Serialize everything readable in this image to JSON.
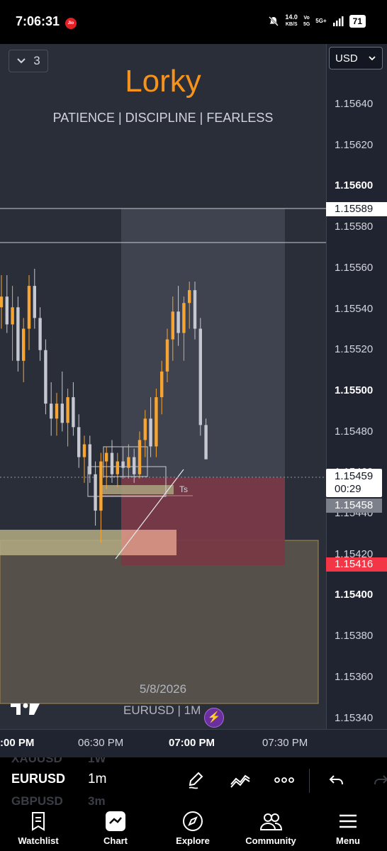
{
  "status_bar": {
    "time": "7:06:31",
    "carrier_badge": "Jio",
    "data_speed_value": "14.0",
    "data_speed_unit": "KB/S",
    "volte_line1": "Vo",
    "volte_line2": "5G",
    "network": "5G+",
    "battery": "71"
  },
  "chart_header": {
    "interval_count": "3",
    "currency": "USD"
  },
  "branding": {
    "title": "Lorky",
    "subtitle": "PATIENCE | DISCIPLINE | FEARLESS"
  },
  "price_axis": {
    "ticks": [
      {
        "label": "1.15640",
        "bold": false
      },
      {
        "label": "1.15620",
        "bold": false
      },
      {
        "label": "1.15600",
        "bold": true
      },
      {
        "label": "1.15580",
        "bold": false
      },
      {
        "label": "1.15560",
        "bold": false
      },
      {
        "label": "1.15540",
        "bold": false
      },
      {
        "label": "1.15520",
        "bold": false
      },
      {
        "label": "1.15500",
        "bold": true
      },
      {
        "label": "1.15480",
        "bold": false
      },
      {
        "label": "1.15460",
        "bold": false
      },
      {
        "label": "1.15440",
        "bold": false
      },
      {
        "label": "1.15420",
        "bold": false
      },
      {
        "label": "1.15400",
        "bold": true
      },
      {
        "label": "1.15380",
        "bold": false
      },
      {
        "label": "1.15360",
        "bold": false
      },
      {
        "label": "1.15340",
        "bold": false
      }
    ],
    "tag_white": "1.15589",
    "tag_current_price": "1.15459",
    "tag_current_countdown": "00:29",
    "tag_gray": "1.15458",
    "tag_red": "1.15416"
  },
  "time_axis": {
    "labels": [
      {
        "label": ":00 PM",
        "bold": true
      },
      {
        "label": "06:30 PM",
        "bold": false
      },
      {
        "label": "07:00 PM",
        "bold": true
      },
      {
        "label": "07:30 PM",
        "bold": false
      }
    ]
  },
  "annotations": {
    "ts_label": "Ts"
  },
  "watermark": {
    "date": "5/8/2026",
    "symbol": "EURUSD | 1M"
  },
  "toolbar": {
    "above_symbol": "XAUUSD",
    "above_interval": "1W",
    "symbol": "EURUSD",
    "interval": "1m",
    "below_symbol": "GBPUSD",
    "below_interval": "3m"
  },
  "bottom_nav": {
    "items": [
      {
        "label": "Watchlist",
        "icon": "watchlist-icon"
      },
      {
        "label": "Chart",
        "icon": "chart-icon"
      },
      {
        "label": "Explore",
        "icon": "compass-icon"
      },
      {
        "label": "Community",
        "icon": "community-icon"
      },
      {
        "label": "Menu",
        "icon": "menu-icon"
      }
    ]
  },
  "colors": {
    "chart_bg": "#2a2e39",
    "up_candle": "#f7a532",
    "down_candle": "#c5c8d0",
    "brand": "#f7931a",
    "stop_zone": "#b03a48",
    "demand_zone": "#4f4940"
  },
  "chart_data": {
    "type": "candlestick",
    "symbol": "EURUSD",
    "interval": "1m",
    "y_axis_range": [
      1.15333,
      1.15653
    ],
    "current_price": 1.15459,
    "candles": [
      {
        "o": 1.1553,
        "h": 1.15545,
        "l": 1.1552,
        "c": 1.15535
      },
      {
        "o": 1.15535,
        "h": 1.15545,
        "l": 1.15518,
        "c": 1.15522
      },
      {
        "o": 1.15522,
        "h": 1.1554,
        "l": 1.15505,
        "c": 1.1553
      },
      {
        "o": 1.1553,
        "h": 1.15535,
        "l": 1.155,
        "c": 1.15505
      },
      {
        "o": 1.15505,
        "h": 1.15525,
        "l": 1.15495,
        "c": 1.1552
      },
      {
        "o": 1.1552,
        "h": 1.15545,
        "l": 1.1551,
        "c": 1.1554
      },
      {
        "o": 1.1554,
        "h": 1.15548,
        "l": 1.1552,
        "c": 1.15525
      },
      {
        "o": 1.15525,
        "h": 1.1553,
        "l": 1.15505,
        "c": 1.1551
      },
      {
        "o": 1.1551,
        "h": 1.15515,
        "l": 1.1548,
        "c": 1.15485
      },
      {
        "o": 1.15485,
        "h": 1.15495,
        "l": 1.1547,
        "c": 1.15478
      },
      {
        "o": 1.15478,
        "h": 1.1549,
        "l": 1.1547,
        "c": 1.15485
      },
      {
        "o": 1.15485,
        "h": 1.155,
        "l": 1.15472,
        "c": 1.15476
      },
      {
        "o": 1.15476,
        "h": 1.15492,
        "l": 1.15465,
        "c": 1.15488
      },
      {
        "o": 1.15488,
        "h": 1.15495,
        "l": 1.1547,
        "c": 1.15474
      },
      {
        "o": 1.15474,
        "h": 1.1548,
        "l": 1.15455,
        "c": 1.1546
      },
      {
        "o": 1.1546,
        "h": 1.1547,
        "l": 1.15448,
        "c": 1.15466
      },
      {
        "o": 1.15466,
        "h": 1.1547,
        "l": 1.15448,
        "c": 1.15452
      },
      {
        "o": 1.15452,
        "h": 1.15458,
        "l": 1.15428,
        "c": 1.15435
      },
      {
        "o": 1.15435,
        "h": 1.15462,
        "l": 1.1542,
        "c": 1.15458
      },
      {
        "o": 1.15458,
        "h": 1.15465,
        "l": 1.15445,
        "c": 1.15462
      },
      {
        "o": 1.15462,
        "h": 1.15468,
        "l": 1.15448,
        "c": 1.15452
      },
      {
        "o": 1.15452,
        "h": 1.15462,
        "l": 1.15446,
        "c": 1.15458
      },
      {
        "o": 1.15458,
        "h": 1.15465,
        "l": 1.1545,
        "c": 1.15455
      },
      {
        "o": 1.15455,
        "h": 1.15466,
        "l": 1.1545,
        "c": 1.1546
      },
      {
        "o": 1.1546,
        "h": 1.15464,
        "l": 1.15448,
        "c": 1.15452
      },
      {
        "o": 1.15452,
        "h": 1.15472,
        "l": 1.1545,
        "c": 1.15468
      },
      {
        "o": 1.15468,
        "h": 1.15482,
        "l": 1.1546,
        "c": 1.15478
      },
      {
        "o": 1.15478,
        "h": 1.15488,
        "l": 1.1546,
        "c": 1.15465
      },
      {
        "o": 1.15465,
        "h": 1.15492,
        "l": 1.1546,
        "c": 1.15488
      },
      {
        "o": 1.15488,
        "h": 1.15505,
        "l": 1.1548,
        "c": 1.155
      },
      {
        "o": 1.155,
        "h": 1.1552,
        "l": 1.15495,
        "c": 1.15515
      },
      {
        "o": 1.15515,
        "h": 1.15535,
        "l": 1.15505,
        "c": 1.15528
      },
      {
        "o": 1.15528,
        "h": 1.1554,
        "l": 1.15512,
        "c": 1.15518
      },
      {
        "o": 1.15518,
        "h": 1.15535,
        "l": 1.15505,
        "c": 1.15532
      },
      {
        "o": 1.15532,
        "h": 1.15542,
        "l": 1.1552,
        "c": 1.15538
      },
      {
        "o": 1.15538,
        "h": 1.15542,
        "l": 1.15515,
        "c": 1.1552
      },
      {
        "o": 1.1552,
        "h": 1.15525,
        "l": 1.1547,
        "c": 1.15475
      },
      {
        "o": 1.15475,
        "h": 1.15478,
        "l": 1.15459,
        "c": 1.15459
      }
    ],
    "horizontal_lines": [
      1.15589,
      1.15574
    ],
    "stop_zone": [
      1.15416,
      1.15459
    ],
    "demand_zone": [
      1.1536,
      1.15428
    ]
  }
}
